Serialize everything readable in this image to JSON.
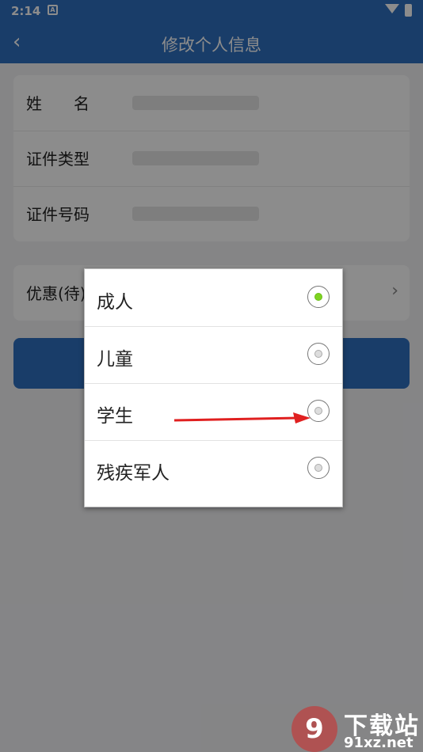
{
  "status_bar": {
    "time": "2:14",
    "notif_glyph": "A"
  },
  "header": {
    "title": "修改个人信息",
    "back_glyph": "‹"
  },
  "form": {
    "name_label": "姓　　名",
    "id_type_label": "证件类型",
    "id_number_label": "证件号码"
  },
  "discount": {
    "label": "优惠(待)",
    "chevron": "›"
  },
  "dialog": {
    "options": [
      {
        "label": "成人",
        "selected": true
      },
      {
        "label": "儿童",
        "selected": false
      },
      {
        "label": "学生",
        "selected": false
      },
      {
        "label": "残疾军人",
        "selected": false
      }
    ]
  },
  "watermark": {
    "logo_text": "9",
    "cn_text": "下载站",
    "en_text": "91xz.net"
  },
  "colors": {
    "brand": "#2f6fbf",
    "selected": "#7ed321",
    "arrow": "#e02020"
  }
}
